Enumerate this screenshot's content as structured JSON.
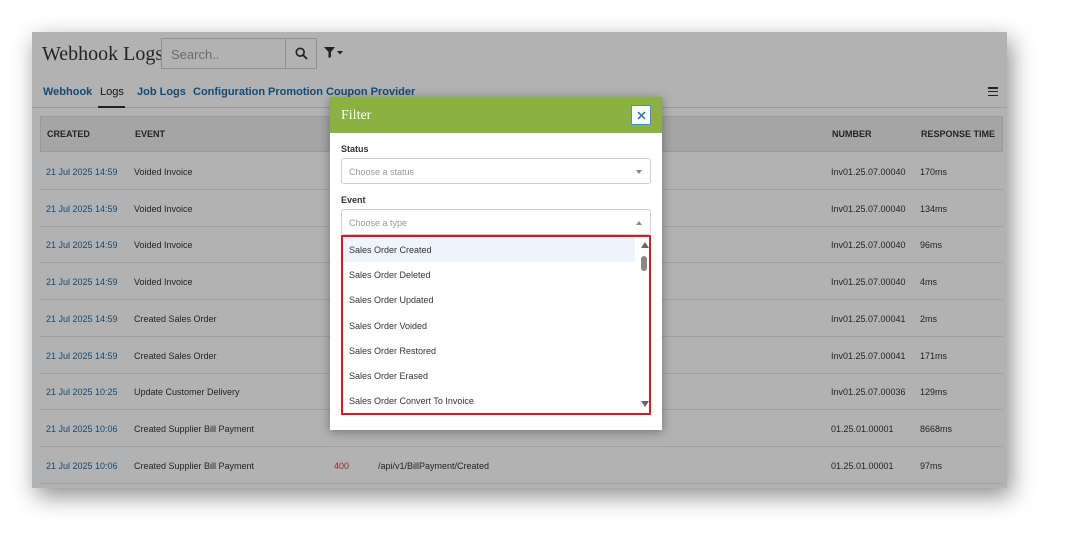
{
  "header": {
    "title": "Webhook Logs",
    "search_placeholder": "Search..",
    "search_icon": "search-icon",
    "filter_icon": "filter-dropdown-icon"
  },
  "tabs": [
    {
      "label": "Webhook",
      "active": false
    },
    {
      "label": "Logs",
      "active": true
    },
    {
      "label": "Job Logs",
      "active": false
    },
    {
      "label": "Configuration",
      "active": false
    },
    {
      "label": "Promotion Coupon Provider",
      "active": false
    }
  ],
  "table": {
    "headers": [
      "CREATED",
      "EVENT",
      "NUMBER",
      "RESPONSE TIME"
    ],
    "rows": [
      {
        "created": "21 Jul 2025 14:59",
        "event": "Voided Invoice",
        "code": "",
        "path": "",
        "number": "Inv01.25.07.00040",
        "response_time": "170ms"
      },
      {
        "created": "21 Jul 2025 14:59",
        "event": "Voided Invoice",
        "code": "",
        "path": "",
        "number": "Inv01.25.07.00040",
        "response_time": "134ms"
      },
      {
        "created": "21 Jul 2025 14:59",
        "event": "Voided Invoice",
        "code": "",
        "path": "",
        "number": "Inv01.25.07.00040",
        "response_time": "96ms"
      },
      {
        "created": "21 Jul 2025 14:59",
        "event": "Voided Invoice",
        "code": "",
        "path": "",
        "number": "Inv01.25.07.00040",
        "response_time": "4ms"
      },
      {
        "created": "21 Jul 2025 14:59",
        "event": "Created Sales Order",
        "code": "",
        "path": "",
        "number": "Inv01.25.07.00041",
        "response_time": "2ms"
      },
      {
        "created": "21 Jul 2025 14:59",
        "event": "Created Sales Order",
        "code": "",
        "path": "",
        "number": "Inv01.25.07.00041",
        "response_time": "171ms"
      },
      {
        "created": "21 Jul 2025 10:25",
        "event": "Update Customer Delivery",
        "code": "",
        "path": "",
        "number": "Inv01.25.07.00036",
        "response_time": "129ms"
      },
      {
        "created": "21 Jul 2025 10:06",
        "event": "Created Supplier Bill Payment",
        "code": "",
        "path": "",
        "number": "01.25.01.00001",
        "response_time": "8668ms"
      },
      {
        "created": "21 Jul 2025 10:06",
        "event": "Created Supplier Bill Payment",
        "code": "400",
        "path": "/api/v1/BillPayment/Created",
        "number": "01.25.01.00001",
        "response_time": "97ms"
      }
    ]
  },
  "filter_modal": {
    "title": "Filter",
    "close_icon": "close-icon",
    "status_label": "Status",
    "status_placeholder": "Choose a status",
    "event_label": "Event",
    "event_placeholder": "Choose a type",
    "event_options": [
      "Sales Order Created",
      "Sales Order Deleted",
      "Sales Order Updated",
      "Sales Order Voided",
      "Sales Order Restored",
      "Sales Order Erased",
      "Sales Order Convert To Invoice"
    ]
  },
  "colors": {
    "modal_header": "#8ab141",
    "link": "#1a6aa8",
    "highlight_border": "#e3161f",
    "error_code": "#d13c3c"
  }
}
